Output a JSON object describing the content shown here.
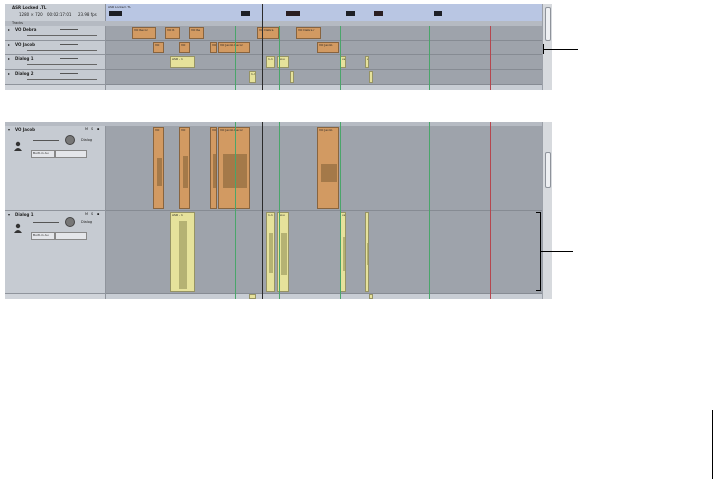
{
  "top_panel": {
    "header": {
      "title": "ASR Locked .TL",
      "line_left": "1280 × 720",
      "line_mid": "00:02:17:01",
      "line_right": "23.98 fps"
    },
    "ruler_label": "ASR Locked .TL",
    "tracks_label": "Tracks",
    "tracks": [
      {
        "name": "VO Debra",
        "color": "orange"
      },
      {
        "name": "VO Jacob",
        "color": "orange"
      },
      {
        "name": "Dialog 1",
        "color": "yellow"
      },
      {
        "name": "Dialog 2",
        "color": "yellow"
      }
    ],
    "regions_row1": [
      "VO Recor",
      "VO R",
      "VO Re",
      "VO Debra",
      "VO Debra r"
    ],
    "regions_row2": [
      "VO",
      "VO",
      "VO",
      "VO Jacob Recor",
      "VO Jacob"
    ],
    "regions_row3": [
      "ASR - 1",
      "1-1",
      "Sou",
      "ve",
      "e"
    ],
    "regions_row4": [
      "1-1"
    ]
  },
  "bottom_panel": {
    "track1": {
      "name": "VO Jacob",
      "dialog_label": "Dialog",
      "built_in": "Built-in Au"
    },
    "track2": {
      "name": "Dialog 1",
      "dialog_label": "Dialog",
      "built_in": "Built-in Au"
    },
    "regions_vo": [
      "VO",
      "VO",
      "VO",
      "VO Jacob Recor",
      "VO Jacob"
    ],
    "regions_dialog": [
      "ASR - 1",
      "1-1",
      "Sou",
      "ve"
    ]
  },
  "colors": {
    "orange_region": "#d29a62",
    "yellow_region": "#e6e29b",
    "marker_green": "#4aa56a",
    "marker_red": "#b5464e"
  },
  "icons": [
    "disclosure-triangle-icon",
    "mute-icon",
    "solo-icon",
    "lock-icon",
    "person-icon",
    "speaker-icon"
  ]
}
